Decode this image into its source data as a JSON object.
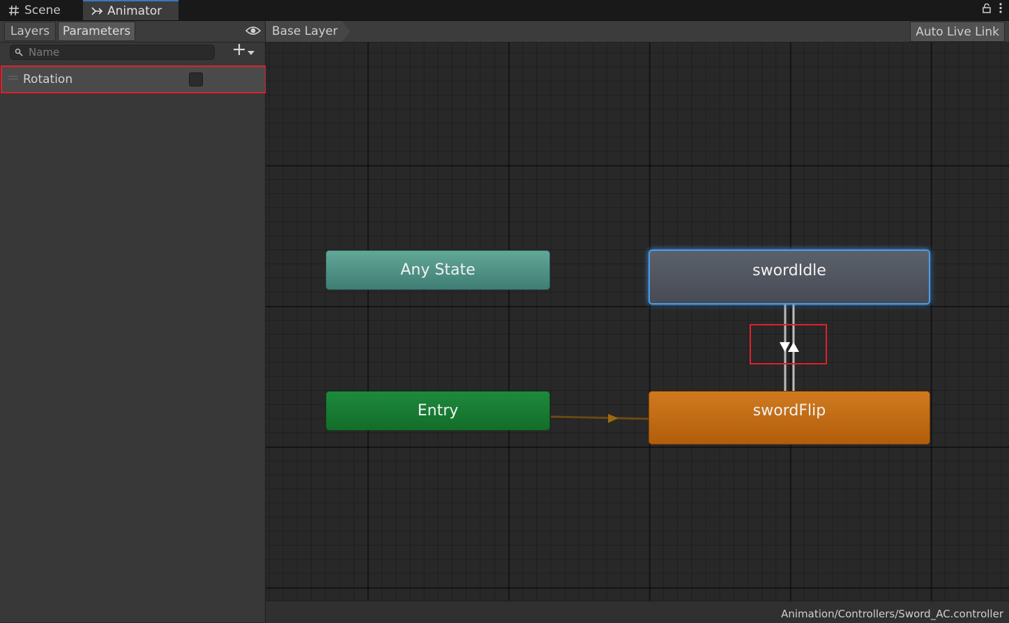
{
  "tabs": {
    "scene": "Scene",
    "animator": "Animator"
  },
  "left_panel": {
    "layers_tab": "Layers",
    "parameters_tab": "Parameters",
    "search_placeholder": "Name",
    "parameters": [
      {
        "name": "Rotation",
        "type": "bool",
        "value": false
      }
    ]
  },
  "graph": {
    "breadcrumb": "Base Layer",
    "auto_live_link": "Auto Live Link",
    "states": {
      "any": "Any State",
      "entry": "Entry",
      "idle": "swordIdle",
      "flip": "swordFlip"
    },
    "colors": {
      "any": "#4f9287",
      "entry": "#187c33",
      "idle": "#50555e",
      "flip": "#c46c15",
      "selection": "#4e9be6",
      "highlight": "#e0212c"
    }
  },
  "status": {
    "path": "Animation/Controllers/Sword_AC.controller"
  }
}
